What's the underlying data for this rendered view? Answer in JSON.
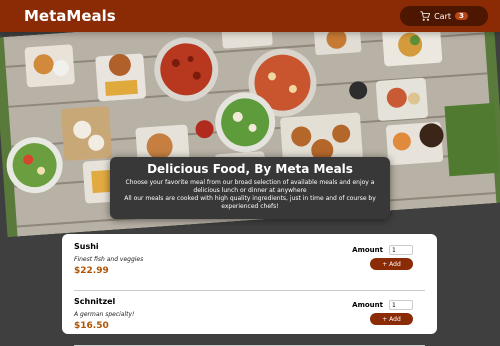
{
  "header": {
    "brand": "MetaMeals",
    "cart_label": "Cart",
    "cart_count": "3"
  },
  "summary": {
    "title": "Delicious Food, By Meta Meals",
    "line1": "Choose your favorite meal from our broad selection of available meals and enjoy a delicious lunch or dinner at anywhere",
    "line2": "All our meals are cooked with high quality ingredients, just in time and of course by experienced chefs!"
  },
  "meals": [
    {
      "name": "Sushi",
      "description": "Finest fish and veggies",
      "price": "$22.99",
      "amount_label": "Amount",
      "amount_value": "1",
      "add_label": "+ Add"
    },
    {
      "name": "Schnitzel",
      "description": "A german specialty!",
      "price": "$16.50",
      "amount_label": "Amount",
      "amount_value": "1",
      "add_label": "+ Add"
    }
  ],
  "colors": {
    "header_bg": "#8a2b06",
    "cart_bg": "#4d1601",
    "price": "#ad5502",
    "page_bg": "#3f3f3f"
  }
}
